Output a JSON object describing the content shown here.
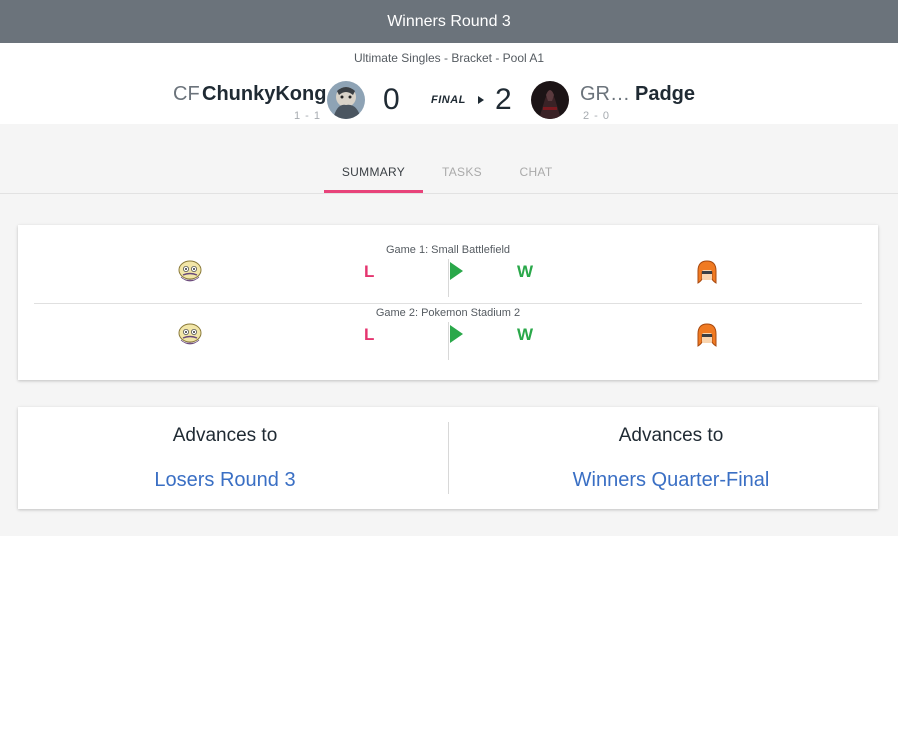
{
  "header": {
    "title": "Winners Round 3"
  },
  "match": {
    "subtitle": "Ultimate Singles - Bracket - Pool A1",
    "status": "FINAL",
    "player1": {
      "tag": "CF",
      "name": "ChunkyKong",
      "record": "1 - 1",
      "score": "0",
      "avatar": "player1-avatar"
    },
    "player2": {
      "tag": "GR…",
      "name": "Padge",
      "record": "2 - 0",
      "score": "2",
      "avatar": "player2-avatar"
    }
  },
  "tabs": [
    {
      "label": "SUMMARY",
      "active": true
    },
    {
      "label": "TASKS",
      "active": false
    },
    {
      "label": "CHAT",
      "active": false
    }
  ],
  "games": [
    {
      "label": "Game 1: Small Battlefield",
      "p1_result": "L",
      "p2_result": "W",
      "p1_character_icon": "wario-icon",
      "p2_character_icon": "inkling-icon"
    },
    {
      "label": "Game 2: Pokemon Stadium 2",
      "p1_result": "L",
      "p2_result": "W",
      "p1_character_icon": "wario-icon",
      "p2_character_icon": "inkling-icon"
    }
  ],
  "advances": {
    "left": {
      "label": "Advances to",
      "link": "Losers Round 3"
    },
    "right": {
      "label": "Advances to",
      "link": "Winners Quarter-Final"
    }
  },
  "colors": {
    "header_bg": "#6b737b",
    "loss": "#e5356f",
    "win": "#2aa84a",
    "link": "#3a6fc4",
    "tab_accent": "#e8437a"
  }
}
